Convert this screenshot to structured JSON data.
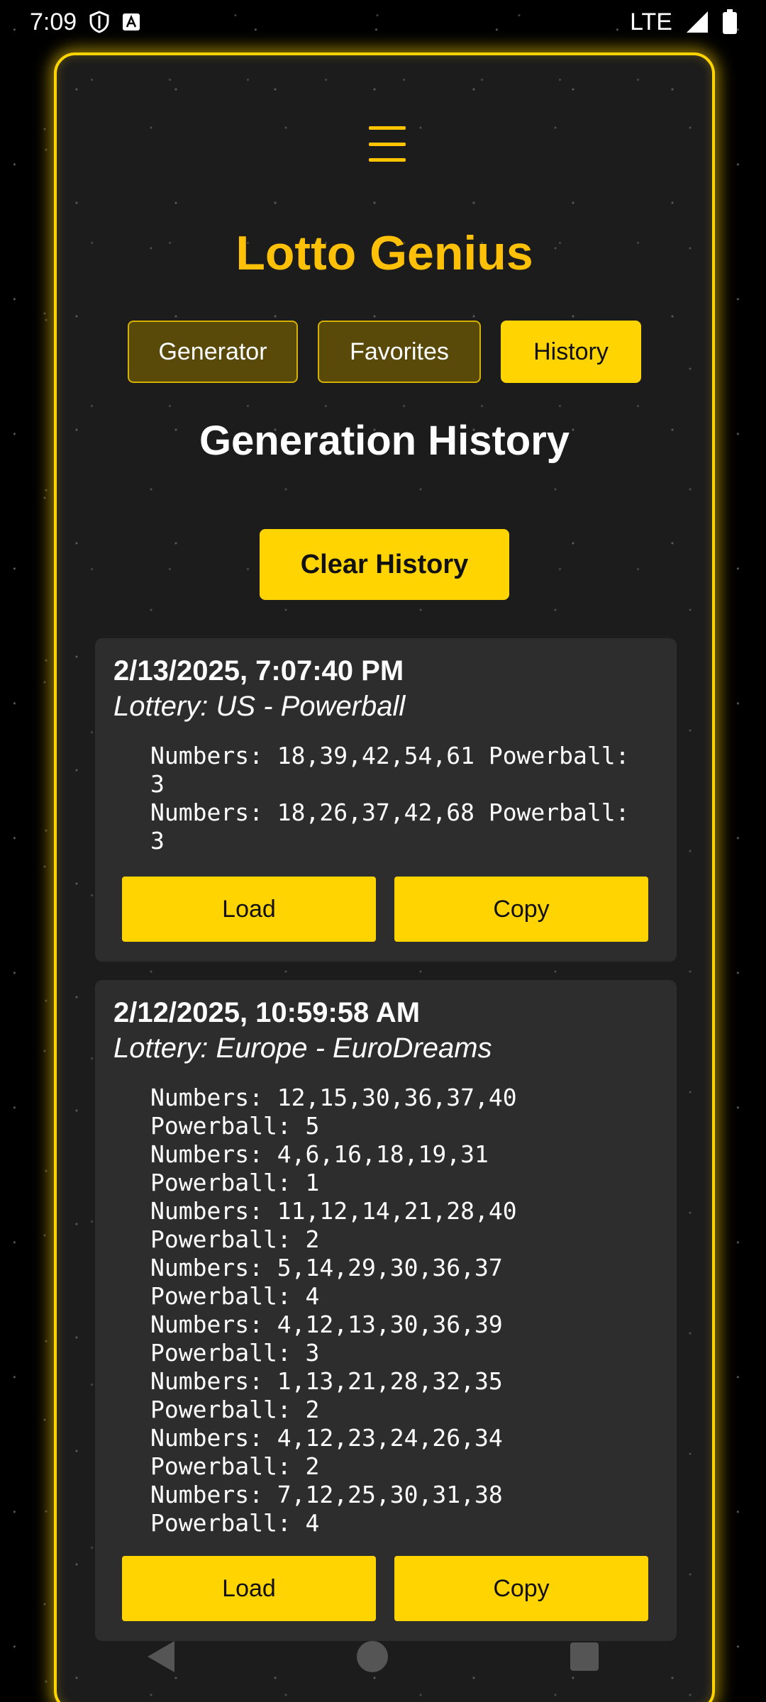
{
  "status_bar": {
    "time": "7:09",
    "network": "LTE",
    "icons": [
      "shield-icon",
      "a-icon",
      "signal-icon",
      "battery-icon"
    ]
  },
  "header": {
    "title": "Lotto Genius",
    "menu_icon": "hamburger-menu-icon"
  },
  "tabs": [
    {
      "label": "Generator",
      "active": false
    },
    {
      "label": "Favorites",
      "active": false
    },
    {
      "label": "History",
      "active": true
    }
  ],
  "main": {
    "section_title": "Generation History",
    "clear_label": "Clear History"
  },
  "history": [
    {
      "date": "2/13/2025, 7:07:40 PM",
      "lottery": "Lottery: US - Powerball",
      "lines": "Numbers: 18,39,42,54,61 Powerball:\n3\nNumbers: 18,26,37,42,68 Powerball:\n3",
      "load_label": "Load",
      "copy_label": "Copy"
    },
    {
      "date": "2/12/2025, 10:59:58 AM",
      "lottery": "Lottery: Europe - EuroDreams",
      "lines": "Numbers: 12,15,30,36,37,40\nPowerball: 5\nNumbers: 4,6,16,18,19,31\nPowerball: 1\nNumbers: 11,12,14,21,28,40\nPowerball: 2\nNumbers: 5,14,29,30,36,37\nPowerball: 4\nNumbers: 4,12,13,30,36,39\nPowerball: 3\nNumbers: 1,13,21,28,32,35\nPowerball: 2\nNumbers: 4,12,23,24,26,34\nPowerball: 2\nNumbers: 7,12,25,30,31,38\nPowerball: 4",
      "load_label": "Load",
      "copy_label": "Copy"
    }
  ],
  "colors": {
    "accent": "#ffd400",
    "title": "#ffc107",
    "card_bg": "#2d2d2d",
    "frame_bg": "#1c1c1c"
  }
}
